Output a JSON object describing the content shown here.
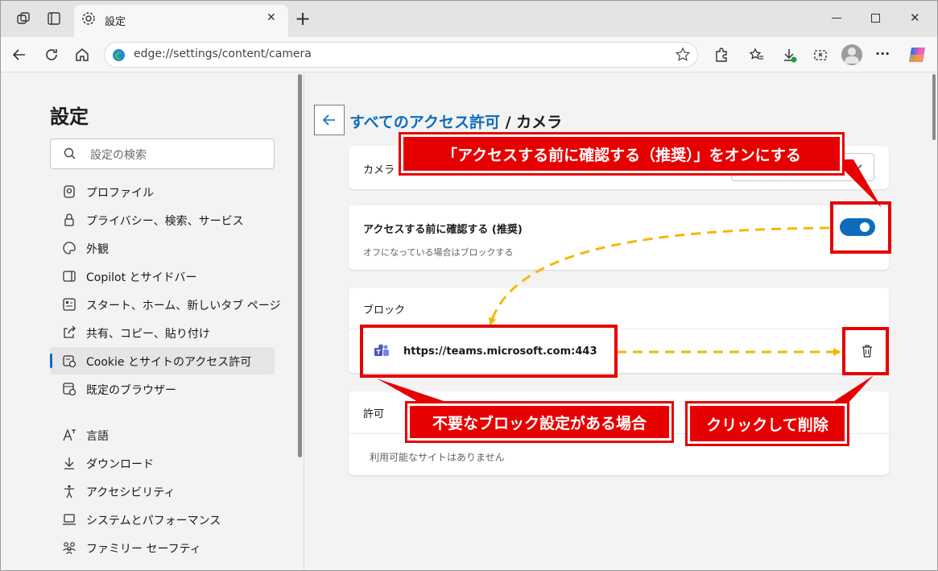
{
  "browser": {
    "tab_title": "設定",
    "url": "edge://settings/content/camera",
    "new_tab_symbol": "+",
    "close_tab_symbol": "✕",
    "more_symbol": "···"
  },
  "sidebar": {
    "title": "設定",
    "search_placeholder": "設定の検索",
    "items": [
      {
        "label": "プロファイル",
        "icon": "profile-icon"
      },
      {
        "label": "プライバシー、検索、サービス",
        "icon": "lock-icon"
      },
      {
        "label": "外観",
        "icon": "palette-icon"
      },
      {
        "label": "Copilot とサイドバー",
        "icon": "sidebar-icon"
      },
      {
        "label": "スタート、ホーム、新しいタブ ページ",
        "icon": "home-grid-icon"
      },
      {
        "label": "共有、コピー、貼り付け",
        "icon": "share-icon"
      },
      {
        "label": "Cookie とサイトのアクセス許可",
        "icon": "cookie-icon",
        "active": true
      },
      {
        "label": "既定のブラウザー",
        "icon": "browser-icon"
      },
      {
        "label": "言語",
        "icon": "language-icon"
      },
      {
        "label": "ダウンロード",
        "icon": "download-icon"
      },
      {
        "label": "アクセシビリティ",
        "icon": "accessibility-icon"
      },
      {
        "label": "システムとパフォーマンス",
        "icon": "laptop-icon"
      },
      {
        "label": "ファミリー セーフティ",
        "icon": "family-icon"
      }
    ]
  },
  "main": {
    "breadcrumb_link": "すべてのアクセス許可",
    "breadcrumb_current": " / カメラ",
    "camera_label": "カメラ",
    "ask_title": "アクセスする前に確認する (推奨)",
    "ask_subtitle": "オフになっている場合はブロックする",
    "ask_enabled": true,
    "block_header": "ブロック",
    "blocked_site": "https://teams.microsoft.com:443",
    "allow_header": "許可",
    "allow_empty": "利用可能なサイトはありません"
  },
  "annotations": {
    "callout_toggle": "「アクセスする前に確認する（推奨）」をオンにする",
    "callout_block": "不要なブロック設定がある場合",
    "callout_delete": "クリックして削除",
    "colors": {
      "red": "#e60000",
      "arrow": "#f5b800",
      "accent": "#0f6cbd"
    }
  }
}
